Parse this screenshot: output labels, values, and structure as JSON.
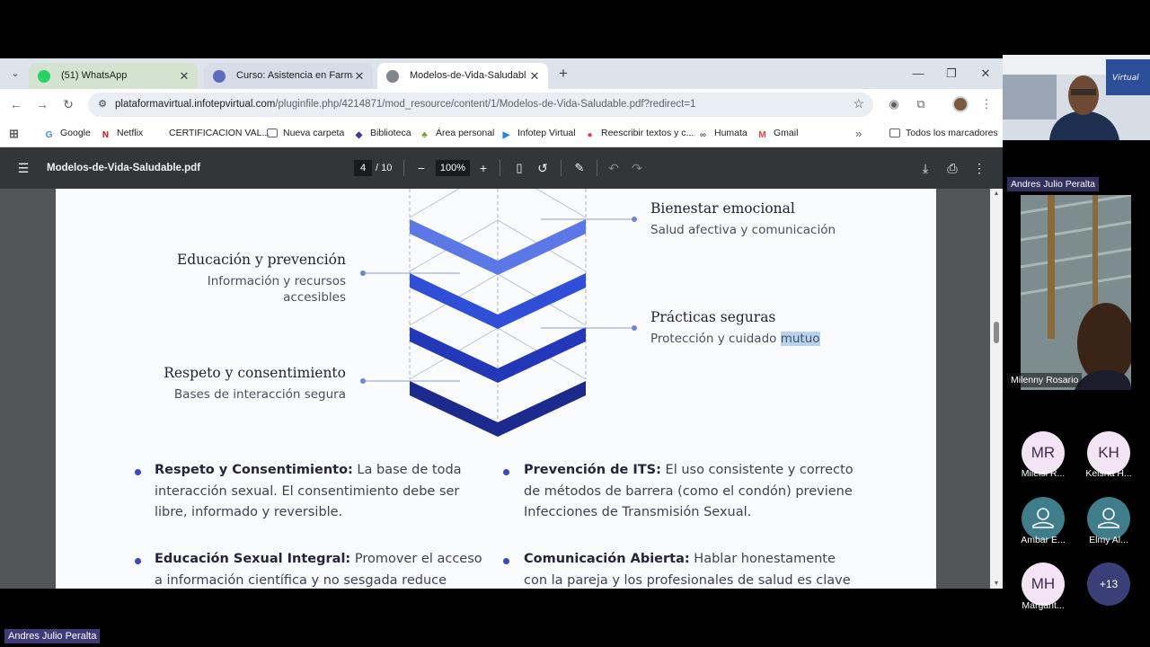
{
  "browser": {
    "tabs": [
      {
        "title": "(51) WhatsApp",
        "icon": "whatsapp-icon",
        "color": "#25d366"
      },
      {
        "title": "Curso: Asistencia en Farmacia A",
        "icon": "course-icon",
        "color": "#5c6bc0"
      },
      {
        "title": "Modelos-de-Vida-Saludable.pdf",
        "icon": "globe-icon",
        "color": "#80868b"
      }
    ],
    "url_host": "plataformavirtual.infotepvirtual.com",
    "url_path": "/pluginfile.php/4214871/mod_resource/content/1/Modelos-de-Vida-Saludable.pdf?redirect=1",
    "bookmarks": [
      {
        "label": "Google",
        "icon": "google-icon",
        "color": "#4285f4",
        "glyph": "G"
      },
      {
        "label": "Netflix",
        "icon": "netflix-icon",
        "color": "#e50914",
        "glyph": "N"
      },
      {
        "label": "CERTIFICACION VAL...",
        "icon": "bookmark-icon",
        "color": "#ffffff",
        "glyph": ""
      },
      {
        "label": "Nueva carpeta",
        "icon": "folder-icon",
        "color": "#ffffff",
        "glyph": "▭"
      },
      {
        "label": "Biblioteca",
        "icon": "shield-icon",
        "color": "#3c3f8f",
        "glyph": "◆"
      },
      {
        "label": "Área personal",
        "icon": "area-icon",
        "color": "#7a9a3a",
        "glyph": "♣"
      },
      {
        "label": "Infotep Virtual",
        "icon": "infotep-icon",
        "color": "#1e88e5",
        "glyph": "▶"
      },
      {
        "label": "Reescribir textos y c...",
        "icon": "rewrite-icon",
        "color": "#e53935",
        "glyph": "●"
      },
      {
        "label": "Humata",
        "icon": "humata-icon",
        "color": "#6d4c41",
        "glyph": "∞"
      },
      {
        "label": "Gmail",
        "icon": "gmail-icon",
        "color": "#ea4335",
        "glyph": "M"
      }
    ],
    "all_bookmarks": "Todos los marcadores"
  },
  "pdf": {
    "filename": "Modelos-de-Vida-Saludable.pdf",
    "page": "4",
    "total": "/ 10",
    "zoom": "100%"
  },
  "page_content": {
    "left_items": [
      {
        "title": "Educación y prevención",
        "sub1": "Información y recursos",
        "sub2": "accesibles"
      },
      {
        "title": "Respeto y consentimiento",
        "sub1": "Bases de interacción segura"
      }
    ],
    "right_items": [
      {
        "title": "Bienestar emocional",
        "sub": "Salud afectiva y comunicación"
      },
      {
        "title": "Prácticas seguras",
        "sub": "Protección y cuidado",
        "sub_highlight": "mutuo"
      }
    ],
    "bullets": [
      {
        "bold": "Respeto y Consentimiento:",
        "text": " La base de toda interacción sexual. El consentimiento debe ser libre, informado y reversible."
      },
      {
        "bold": "Prevención de ITS:",
        "text": " El uso consistente y correcto de métodos de barrera (como el condón) previene Infecciones de Transmisión Sexual."
      },
      {
        "bold": "Educación Sexual Integral:",
        "text": " Promover el acceso a información científica y no sesgada reduce"
      },
      {
        "bold": "Comunicación Abierta:",
        "text": " Hablar honestamente con la pareja y los profesionales de salud es clave para"
      }
    ],
    "colors": {
      "chevron1": "#5b78e6",
      "chevron2": "#2f4fd8",
      "chevron3": "#2338b8",
      "chevron4": "#1b2a8c",
      "accent": "#3848c9"
    }
  },
  "meeting": {
    "self_name": "Andres Julio Peralta",
    "video_name": "Milenny Rosario",
    "participants": [
      {
        "initials": "MR",
        "name": "Mileisi R..."
      },
      {
        "initials": "KH",
        "name": "Keisha H..."
      },
      {
        "initials": "",
        "name": "Ambar E..."
      },
      {
        "initials": "",
        "name": "Elmy Al..."
      },
      {
        "initials": "MH",
        "name": "Margarit..."
      },
      {
        "initials": "+13",
        "name": ""
      }
    ],
    "bottom_label": "Andres Julio Peralta"
  }
}
